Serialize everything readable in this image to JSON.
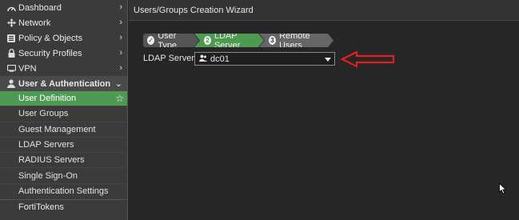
{
  "sidebar": {
    "top_items": [
      {
        "label": "Dashboard",
        "icon": "dashboard-icon"
      },
      {
        "label": "Network",
        "icon": "network-icon"
      },
      {
        "label": "Policy & Objects",
        "icon": "policy-icon"
      },
      {
        "label": "Security Profiles",
        "icon": "lock-icon"
      },
      {
        "label": "VPN",
        "icon": "vpn-icon"
      }
    ],
    "expanded": {
      "label": "User & Authentication",
      "icon": "user-icon"
    },
    "sub_items": [
      {
        "label": "User Definition",
        "active": true
      },
      {
        "label": "User Groups"
      },
      {
        "label": "Guest Management"
      },
      {
        "label": "LDAP Servers"
      },
      {
        "label": "RADIUS Servers"
      },
      {
        "label": "Single Sign-On"
      },
      {
        "label": "Authentication Settings"
      }
    ],
    "bottom_item": {
      "label": "FortiTokens"
    }
  },
  "main": {
    "title": "Users/Groups Creation Wizard",
    "steps": [
      {
        "number": "✓",
        "label": "User Type",
        "state": "done"
      },
      {
        "number": "2",
        "label": "LDAP Server",
        "state": "current"
      },
      {
        "number": "3",
        "label": "Remote Users",
        "state": "next"
      }
    ],
    "ldap_field": {
      "label": "LDAP Server",
      "value": "dc01"
    }
  },
  "colors": {
    "accent_green": "#4e9a53",
    "annotation_red": "#e02020"
  }
}
